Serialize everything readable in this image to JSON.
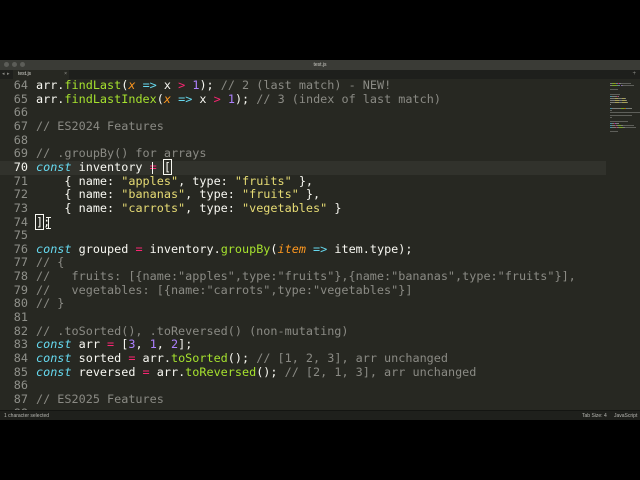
{
  "window": {
    "title": "test.js",
    "tab": {
      "label": "test.js",
      "close_glyph": "×",
      "active": true
    },
    "add_tab_glyph": "+",
    "nav_back_glyph": "◂",
    "nav_forward_glyph": "▸"
  },
  "editor": {
    "language": "JavaScript",
    "active_line": 70,
    "theme": {
      "background": "#272822",
      "keyword": "#66d9ef",
      "function": "#a6e22e",
      "string": "#e6db74",
      "number": "#ae81ff",
      "operator": "#f92672",
      "comment": "#8a8a84",
      "param": "#fd971f"
    },
    "lines": [
      {
        "n": "64",
        "tokens": [
          [
            "pl",
            "arr."
          ],
          [
            "fn",
            "findLast"
          ],
          [
            "pl",
            "("
          ],
          [
            "par",
            "x"
          ],
          [
            "pl",
            " "
          ],
          [
            "kw",
            "=>"
          ],
          [
            "pl",
            " x "
          ],
          [
            "op",
            ">"
          ],
          [
            "pl",
            " "
          ],
          [
            "num",
            "1"
          ],
          [
            "pl",
            "); "
          ],
          [
            "cmt",
            "// 2 (last match) - NEW!"
          ]
        ]
      },
      {
        "n": "65",
        "tokens": [
          [
            "pl",
            "arr."
          ],
          [
            "fn",
            "findLastIndex"
          ],
          [
            "pl",
            "("
          ],
          [
            "par",
            "x"
          ],
          [
            "pl",
            " "
          ],
          [
            "kw",
            "=>"
          ],
          [
            "pl",
            " x "
          ],
          [
            "op",
            ">"
          ],
          [
            "pl",
            " "
          ],
          [
            "num",
            "1"
          ],
          [
            "pl",
            "); "
          ],
          [
            "cmt",
            "// 3 (index of last match)"
          ]
        ]
      },
      {
        "n": "66",
        "tokens": []
      },
      {
        "n": "67",
        "tokens": [
          [
            "cmt",
            "// ES2024 Features"
          ]
        ]
      },
      {
        "n": "68",
        "tokens": []
      },
      {
        "n": "69",
        "tokens": [
          [
            "cmt",
            "// .groupBy() for arrays"
          ]
        ]
      },
      {
        "n": "70",
        "tokens": [
          [
            "kw",
            "const"
          ],
          [
            "pl",
            " inventory "
          ],
          [
            "op",
            "="
          ],
          [
            "pl",
            " "
          ],
          [
            "br",
            "["
          ]
        ]
      },
      {
        "n": "71",
        "tokens": [
          [
            "pl",
            "    { name: "
          ],
          [
            "str",
            "\"apples\""
          ],
          [
            "pl",
            ", type: "
          ],
          [
            "str",
            "\"fruits\""
          ],
          [
            "pl",
            " },"
          ]
        ]
      },
      {
        "n": "72",
        "tokens": [
          [
            "pl",
            "    { name: "
          ],
          [
            "str",
            "\"bananas\""
          ],
          [
            "pl",
            ", type: "
          ],
          [
            "str",
            "\"fruits\""
          ],
          [
            "pl",
            " },"
          ]
        ]
      },
      {
        "n": "73",
        "tokens": [
          [
            "pl",
            "    { name: "
          ],
          [
            "str",
            "\"carrots\""
          ],
          [
            "pl",
            ", type: "
          ],
          [
            "str",
            "\"vegetables\""
          ],
          [
            "pl",
            " }"
          ]
        ]
      },
      {
        "n": "74",
        "tokens": [
          [
            "br",
            "]"
          ],
          [
            "pl",
            ";"
          ]
        ]
      },
      {
        "n": "75",
        "tokens": []
      },
      {
        "n": "76",
        "tokens": [
          [
            "kw",
            "const"
          ],
          [
            "pl",
            " grouped "
          ],
          [
            "op",
            "="
          ],
          [
            "pl",
            " inventory."
          ],
          [
            "fn",
            "groupBy"
          ],
          [
            "pl",
            "("
          ],
          [
            "par",
            "item"
          ],
          [
            "pl",
            " "
          ],
          [
            "kw",
            "=>"
          ],
          [
            "pl",
            " item.type);"
          ]
        ]
      },
      {
        "n": "77",
        "tokens": [
          [
            "cmt",
            "// {"
          ]
        ]
      },
      {
        "n": "78",
        "tokens": [
          [
            "cmt",
            "//   fruits: [{name:\"apples\",type:\"fruits\"},{name:\"bananas\",type:\"fruits\"}],"
          ]
        ]
      },
      {
        "n": "79",
        "tokens": [
          [
            "cmt",
            "//   vegetables: [{name:\"carrots\",type:\"vegetables\"}]"
          ]
        ]
      },
      {
        "n": "80",
        "tokens": [
          [
            "cmt",
            "// }"
          ]
        ]
      },
      {
        "n": "81",
        "tokens": []
      },
      {
        "n": "82",
        "tokens": [
          [
            "cmt",
            "// .toSorted(), .toReversed() (non-mutating)"
          ]
        ]
      },
      {
        "n": "83",
        "tokens": [
          [
            "kw",
            "const"
          ],
          [
            "pl",
            " arr "
          ],
          [
            "op",
            "="
          ],
          [
            "pl",
            " ["
          ],
          [
            "num",
            "3"
          ],
          [
            "pl",
            ", "
          ],
          [
            "num",
            "1"
          ],
          [
            "pl",
            ", "
          ],
          [
            "num",
            "2"
          ],
          [
            "pl",
            "];"
          ]
        ]
      },
      {
        "n": "84",
        "tokens": [
          [
            "kw",
            "const"
          ],
          [
            "pl",
            " sorted "
          ],
          [
            "op",
            "="
          ],
          [
            "pl",
            " arr."
          ],
          [
            "fn",
            "toSorted"
          ],
          [
            "pl",
            "(); "
          ],
          [
            "cmt",
            "// [1, 2, 3], arr unchanged"
          ]
        ]
      },
      {
        "n": "85",
        "tokens": [
          [
            "kw",
            "const"
          ],
          [
            "pl",
            " reversed "
          ],
          [
            "op",
            "="
          ],
          [
            "pl",
            " arr."
          ],
          [
            "fn",
            "toReversed"
          ],
          [
            "pl",
            "(); "
          ],
          [
            "cmt",
            "// [2, 1, 3], arr unchanged"
          ]
        ]
      },
      {
        "n": "86",
        "tokens": []
      },
      {
        "n": "87",
        "tokens": [
          [
            "cmt",
            "// ES2025 Features"
          ]
        ]
      },
      {
        "n": "88",
        "tokens": []
      }
    ]
  },
  "statusbar": {
    "selection": "1 character selected",
    "tab_size": "Tab Size: 4",
    "syntax": "JavaScript"
  }
}
